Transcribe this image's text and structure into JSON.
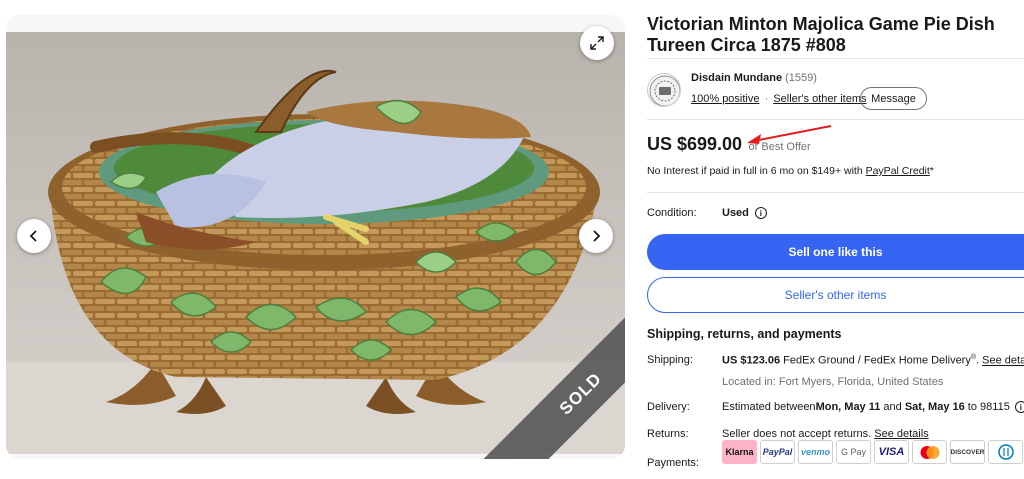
{
  "listing": {
    "title": "Victorian Minton Majolica Game Pie Dish Tureen Circa 1875 #808"
  },
  "gallery": {
    "sold_label": "SOLD",
    "expand_icon": "expand-icon",
    "prev_icon": "chevron-left-icon",
    "next_icon": "chevron-right-icon"
  },
  "seller": {
    "name": "Disdain Mundane",
    "feedback_count": "(1559)",
    "positive": "100% positive",
    "separator": "·",
    "other_items_link": "Seller's other items",
    "message_label": "Message"
  },
  "price": {
    "amount": "US $699.00",
    "best_offer": "or Best Offer",
    "credit_prefix": "No Interest if paid in full in 6 mo on $149+ with ",
    "credit_link": "PayPal Credit",
    "credit_suffix": "*"
  },
  "condition": {
    "label": "Condition:",
    "value": "Used"
  },
  "buttons": {
    "sell_one": "Sell one like this",
    "sellers_other": "Seller's other items"
  },
  "shipping": {
    "heading": "Shipping, returns, and payments",
    "shipping_label": "Shipping:",
    "shipping_cost": "US $123.06",
    "shipping_method": " FedEx Ground / FedEx Home Delivery",
    "shipping_reg": "®",
    "shipping_sep": ". ",
    "shipping_details": "See details",
    "location": "Located in: Fort Myers, Florida, United States",
    "delivery_label": "Delivery:",
    "delivery_prefix": "Estimated between ",
    "delivery_start": "Mon, May 11",
    "delivery_and": " and ",
    "delivery_end": "Sat, May 16",
    "delivery_to": " to 98115",
    "returns_label": "Returns:",
    "returns_text": "Seller does not accept returns. ",
    "returns_details": "See details",
    "payments_label": "Payments:",
    "methods": [
      "Klarna",
      "PayPal",
      "venmo",
      "G Pay",
      "VISA",
      "Mastercard",
      "DISCOVER",
      "Diners Club"
    ]
  },
  "colors": {
    "accent": "#3665f3",
    "arrow": "#e11d1d",
    "sold_band": "#5c5c5c"
  }
}
